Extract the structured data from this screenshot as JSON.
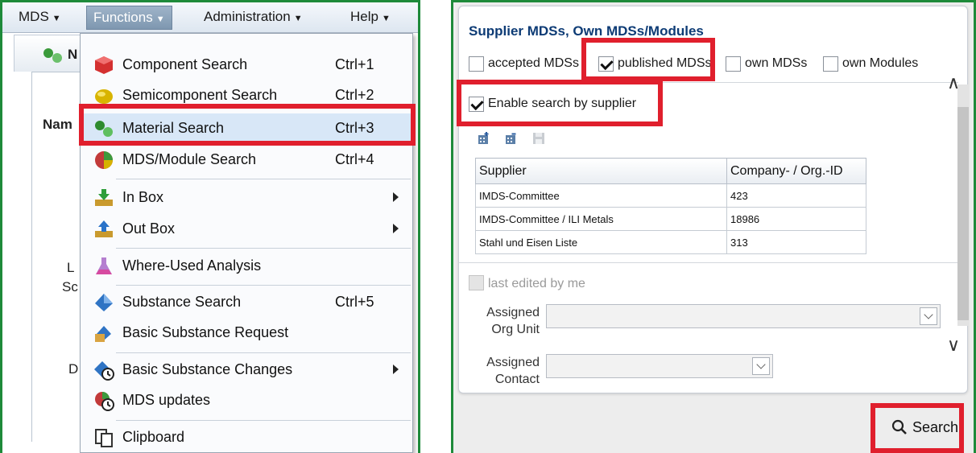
{
  "menubar": {
    "items": [
      {
        "label": "MDS"
      },
      {
        "label": "Functions"
      },
      {
        "label": "Administration"
      },
      {
        "label": "Help"
      }
    ]
  },
  "background": {
    "tab_label": "N",
    "column_label": "Nam",
    "fragments": [
      "L",
      "Sc",
      "D"
    ]
  },
  "functions_menu": {
    "items": [
      {
        "label": "Component Search",
        "shortcut": "Ctrl+1",
        "icon": "red-cube-icon"
      },
      {
        "label": "Semicomponent Search",
        "shortcut": "Ctrl+2",
        "icon": "yellow-sphere-icon"
      },
      {
        "label": "Material Search",
        "shortcut": "Ctrl+3",
        "icon": "green-molecule-icon",
        "highlighted": true
      },
      {
        "label": "MDS/Module Search",
        "shortcut": "Ctrl+4",
        "icon": "multicolor-sphere-icon"
      },
      {
        "label": "In Box",
        "submenu": true,
        "icon": "inbox-icon"
      },
      {
        "label": "Out Box",
        "submenu": true,
        "icon": "outbox-icon"
      },
      {
        "label": "Where-Used Analysis",
        "icon": "flask-icon"
      },
      {
        "label": "Substance Search",
        "shortcut": "Ctrl+5",
        "icon": "blue-crystal-icon"
      },
      {
        "label": "Basic Substance Request",
        "icon": "substance-request-icon"
      },
      {
        "label": "Basic Substance Changes",
        "submenu": true,
        "icon": "substance-changes-icon"
      },
      {
        "label": "MDS updates",
        "icon": "mds-updates-icon"
      },
      {
        "label": "Clipboard",
        "icon": "clipboard-icon"
      }
    ]
  },
  "search_panel": {
    "title": "Supplier MDSs, Own MDSs/Modules",
    "filters": [
      {
        "label": "accepted MDSs",
        "checked": false
      },
      {
        "label": "published MDSs",
        "checked": true
      },
      {
        "label": "own MDSs",
        "checked": false
      },
      {
        "label": "own Modules",
        "checked": false
      }
    ],
    "enable_supplier": {
      "label": "Enable search by supplier",
      "checked": true
    },
    "supplier_table": {
      "columns": [
        "Supplier",
        "Company- / Org.-ID"
      ],
      "rows": [
        [
          "IMDS-Committee",
          "423"
        ],
        [
          "IMDS-Committee / ILI Metals",
          "18986"
        ],
        [
          "Stahl und Eisen Liste",
          "313"
        ]
      ]
    },
    "last_edited": {
      "label": "last edited by me",
      "checked": false,
      "disabled": true
    },
    "assigned_org_unit": {
      "label_line1": "Assigned",
      "label_line2": "Org Unit",
      "value": ""
    },
    "assigned_contact": {
      "label_line1": "Assigned",
      "label_line2": "Contact",
      "value": ""
    },
    "search_button": "Search"
  },
  "colors": {
    "highlight_red": "#e01f2d",
    "frame_green": "#1e8a3a",
    "title_blue": "#0d3b75"
  }
}
